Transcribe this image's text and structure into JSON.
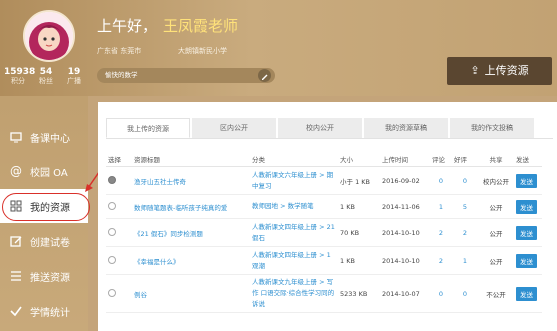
{
  "header": {
    "greeting": "上午好，",
    "teacher_name": "王凤霞老师",
    "location": "广东省 东莞市",
    "school": "大朗镇新民小学",
    "motto": "愉快的数学",
    "upload_label": "上传资源"
  },
  "stats": [
    {
      "value": "15938",
      "label": "积分"
    },
    {
      "value": "54",
      "label": "粉丝"
    },
    {
      "value": "19",
      "label": "广播"
    }
  ],
  "sidebar": {
    "items": [
      {
        "label": "备课中心",
        "icon": "chalkboard-icon"
      },
      {
        "label": "校园 OA",
        "icon": "at-icon"
      },
      {
        "label": "我的资源",
        "icon": "grid-icon"
      },
      {
        "label": "创建试卷",
        "icon": "edit-icon"
      },
      {
        "label": "推送资源",
        "icon": "list-icon"
      },
      {
        "label": "学情统计",
        "icon": "check-icon"
      }
    ]
  },
  "tabs": [
    "我上传的资源",
    "区内公开",
    "校内公开",
    "我的资源草稿",
    "我的作文投稿"
  ],
  "table": {
    "headers": [
      "选择",
      "资源标题",
      "分类",
      "大小",
      "上传时间",
      "评论",
      "好评",
      "共享",
      "发送"
    ],
    "rows": [
      {
        "title": "渔牙山五社士传奇",
        "category": "人教新课文六年级上册 > 期中复习",
        "size": "小于 1 KB",
        "date": "2016-09-02",
        "comments": "0",
        "likes": "0",
        "share": "校内公开",
        "send": "发送"
      },
      {
        "title": "数师随笔题表-临听孩子纯真的爱",
        "category": "教师园地 > 数学随笔",
        "size": "1 KB",
        "date": "2014-11-06",
        "comments": "1",
        "likes": "5",
        "share": "公开",
        "send": "发送"
      },
      {
        "title": "《21 假石》同步检测题",
        "category": "人教新课文四年级上册 > 21假石",
        "size": "70 KB",
        "date": "2014-10-10",
        "comments": "2",
        "likes": "2",
        "share": "公开",
        "send": "发送"
      },
      {
        "title": "《幸福是什么》",
        "category": "人教新课文四年级上册 > 1观潮",
        "size": "1 KB",
        "date": "2014-10-10",
        "comments": "2",
        "likes": "1",
        "share": "公开",
        "send": "发送"
      },
      {
        "title": "例谷",
        "category": "人教新课文九年级上册 > 写作 口语交际·综合性学习同的诉说",
        "size": "5233 KB",
        "date": "2014-10-07",
        "comments": "0",
        "likes": "0",
        "share": "不公开",
        "send": "发送"
      }
    ]
  }
}
